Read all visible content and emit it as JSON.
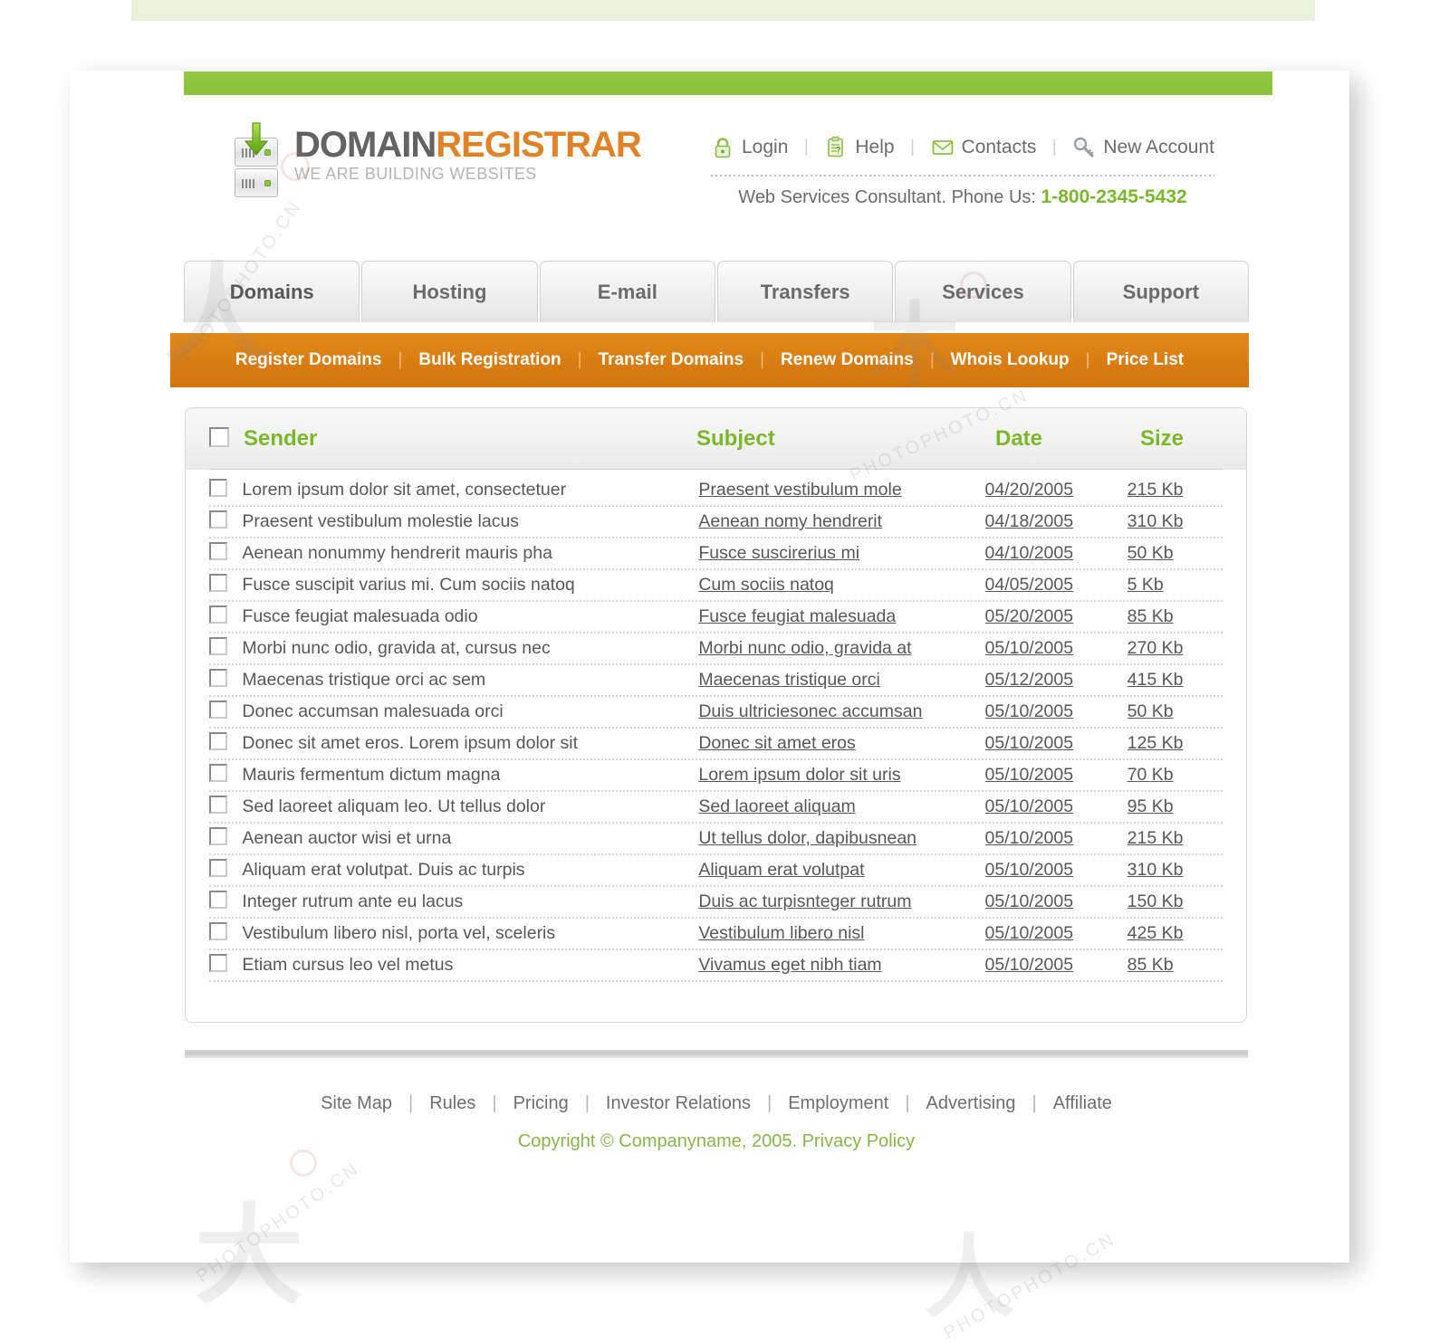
{
  "brand": {
    "name_dark": "DOMAIN",
    "name_accent": "REGISTRAR",
    "tagline": "WE ARE BUILDING WEBSITES",
    "accent_color": "#e08228",
    "green_color": "#8cc63e"
  },
  "util_nav": {
    "items": [
      {
        "label": "Login",
        "icon": "lock-icon"
      },
      {
        "label": "Help",
        "icon": "help-clipboard-icon"
      },
      {
        "label": "Contacts",
        "icon": "envelope-icon"
      },
      {
        "label": "New Account",
        "icon": "key-icon"
      }
    ],
    "separator": "|"
  },
  "phone": {
    "text": "Web Services Consultant. Phone Us:",
    "number": "1-800-2345-5432"
  },
  "tabs": [
    {
      "label": "Domains",
      "active": true
    },
    {
      "label": "Hosting",
      "active": false
    },
    {
      "label": "E-mail",
      "active": false
    },
    {
      "label": "Transfers",
      "active": false
    },
    {
      "label": "Services",
      "active": false
    },
    {
      "label": "Support",
      "active": false
    }
  ],
  "subnav": {
    "items": [
      "Register Domains",
      "Bulk Registration",
      "Transfer Domains",
      "Renew Domains",
      "Whois Lookup",
      "Price List"
    ],
    "separator": "|",
    "background_color": "#d97d12"
  },
  "table": {
    "headers": {
      "sender": "Sender",
      "subject": "Subject",
      "date": "Date",
      "size": "Size"
    },
    "header_color": "#7db82c",
    "rows": [
      {
        "sender": "Lorem ipsum dolor sit amet, consectetuer",
        "subject": "Praesent vestibulum mole",
        "date": "04/20/2005",
        "size": "215 Kb"
      },
      {
        "sender": "Praesent vestibulum molestie lacus",
        "subject": "Aenean nomy hendrerit",
        "date": "04/18/2005",
        "size": "310 Kb"
      },
      {
        "sender": "Aenean nonummy hendrerit mauris pha",
        "subject": "Fusce suscirerius mi",
        "date": "04/10/2005",
        "size": "50 Kb"
      },
      {
        "sender": "Fusce suscipit varius mi. Cum sociis natoq",
        "subject": "Cum sociis natoq",
        "date": "04/05/2005",
        "size": "5 Kb"
      },
      {
        "sender": "Fusce feugiat malesuada odio",
        "subject": "Fusce feugiat malesuada",
        "date": "05/20/2005",
        "size": "85 Kb"
      },
      {
        "sender": "Morbi nunc odio, gravida at, cursus nec",
        "subject": "Morbi nunc odio, gravida at",
        "date": "05/10/2005",
        "size": "270 Kb"
      },
      {
        "sender": "Maecenas tristique orci ac sem",
        "subject": "Maecenas tristique orci",
        "date": "05/12/2005",
        "size": "415 Kb"
      },
      {
        "sender": "Donec accumsan malesuada orci",
        "subject": "Duis ultriciesonec accumsan",
        "date": "05/10/2005",
        "size": "50 Kb"
      },
      {
        "sender": "Donec sit amet eros. Lorem ipsum dolor sit",
        "subject": "Donec sit amet eros",
        "date": "05/10/2005",
        "size": "125 Kb"
      },
      {
        "sender": "Mauris fermentum dictum magna",
        "subject": "Lorem ipsum dolor sit uris",
        "date": "05/10/2005",
        "size": "70 Kb"
      },
      {
        "sender": "Sed laoreet aliquam leo. Ut tellus dolor",
        "subject": "Sed laoreet aliquam",
        "date": "05/10/2005",
        "size": "95 Kb"
      },
      {
        "sender": "Aenean auctor wisi et urna",
        "subject": "Ut tellus dolor, dapibusnean",
        "date": "05/10/2005",
        "size": "215 Kb"
      },
      {
        "sender": "Aliquam erat volutpat. Duis ac turpis",
        "subject": "Aliquam erat volutpat",
        "date": "05/10/2005",
        "size": "310 Kb"
      },
      {
        "sender": "Integer rutrum ante eu lacus",
        "subject": "Duis ac turpisnteger rutrum",
        "date": "05/10/2005",
        "size": "150 Kb"
      },
      {
        "sender": "Vestibulum libero nisl, porta vel, sceleris",
        "subject": "Vestibulum libero nisl",
        "date": "05/10/2005",
        "size": "425 Kb"
      },
      {
        "sender": "Etiam cursus leo vel metus",
        "subject": "Vivamus eget nibh tiam",
        "date": "05/10/2005",
        "size": "85 Kb"
      }
    ]
  },
  "footer": {
    "links": [
      "Site Map",
      "Rules",
      "Pricing",
      "Investor Relations",
      "Employment",
      "Advertising",
      "Affiliate"
    ],
    "separator": "|",
    "copyright": "Copyright © Companyname, 2005. Privacy Policy",
    "copyright_color": "#89b54b"
  },
  "watermarks": {
    "text_a": "PHOTOPHOTO.CN",
    "text_b": "PHOTOPHOTO.CN"
  }
}
